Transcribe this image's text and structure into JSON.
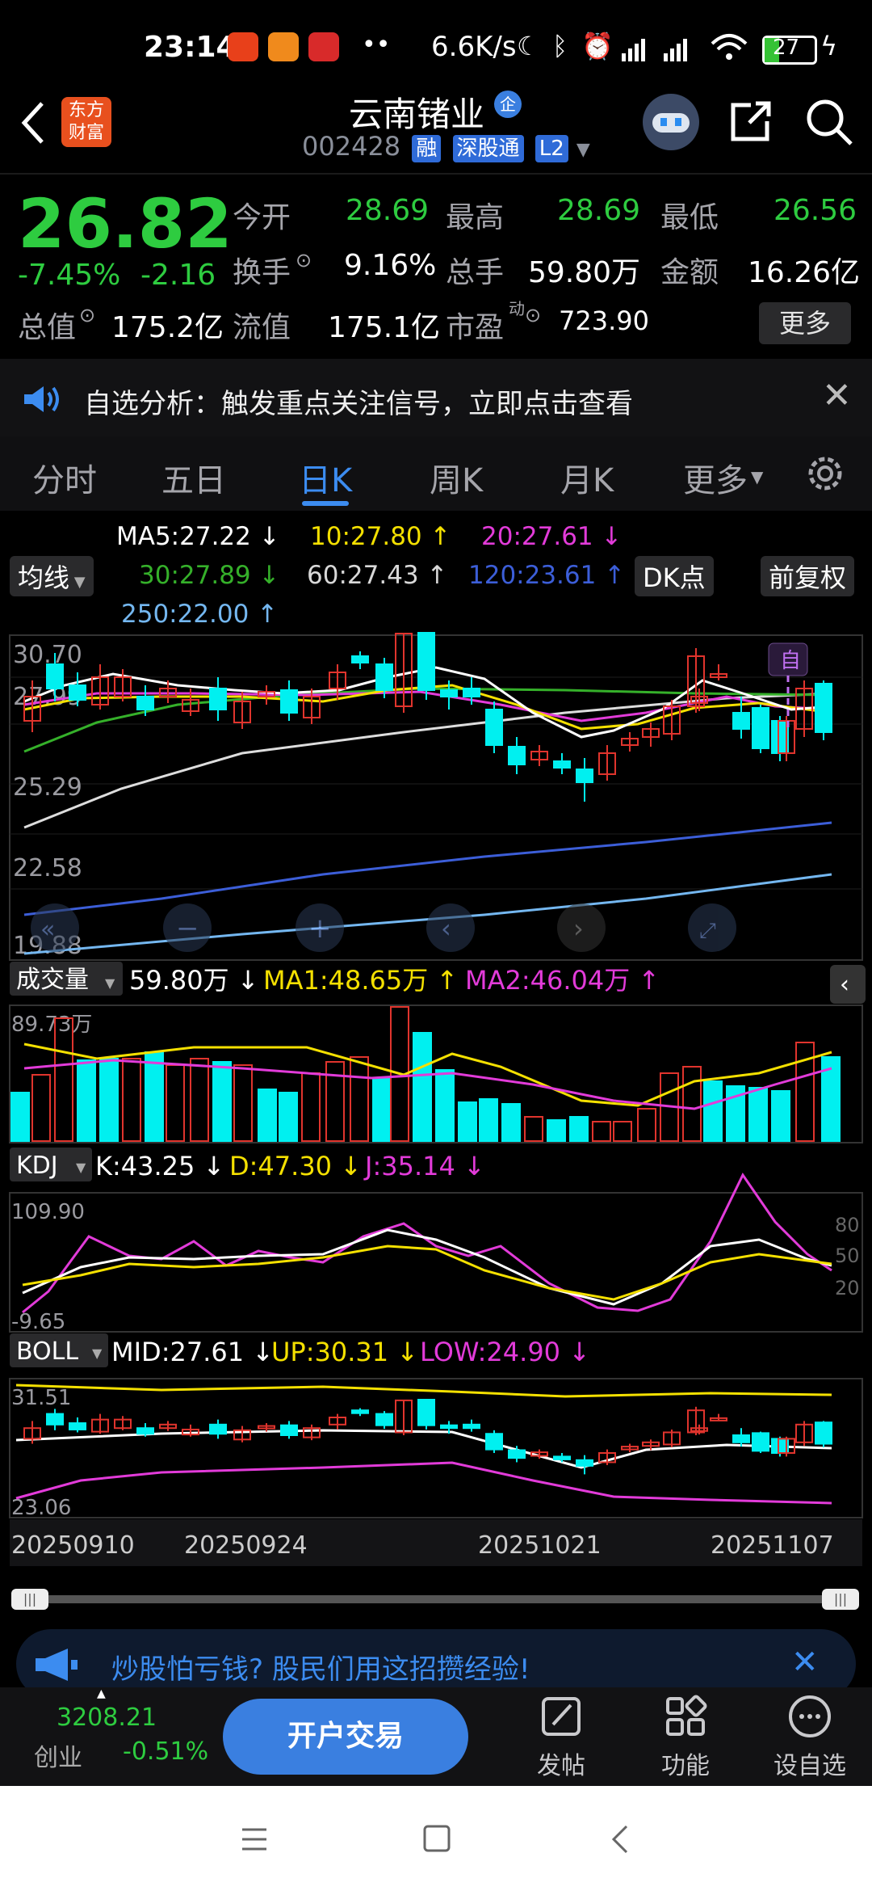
{
  "status": {
    "time": "23:14",
    "speed": "6.6K/s",
    "battery": "27"
  },
  "header": {
    "logo": "东方\n财富",
    "title": "云南锗业",
    "title_badge": "企",
    "code": "002428",
    "tags": [
      "融",
      "深股通",
      "L2"
    ]
  },
  "quote": {
    "price": "26.82",
    "change_pct": "-7.45%",
    "change": "-2.16",
    "open_label": "今开",
    "open": "28.69",
    "high_label": "最高",
    "high": "28.69",
    "low_label": "最低",
    "low": "26.56",
    "turnover_label": "换手",
    "turnover": "9.16%",
    "volume_label": "总手",
    "volume": "59.80万",
    "amount_label": "金额",
    "amount": "16.26亿",
    "mktcap_label": "总值",
    "mktcap": "175.2亿",
    "float_label": "流值",
    "float": "175.1亿",
    "pe_label": "市盈",
    "pe_sup": "动",
    "pe": "723.90",
    "more_label": "更多"
  },
  "notice": {
    "text": "自选分析：触发重点关注信号，立即点击查看"
  },
  "tabs": [
    {
      "label": "分时"
    },
    {
      "label": "五日"
    },
    {
      "label": "日K"
    },
    {
      "label": "周K"
    },
    {
      "label": "月K"
    },
    {
      "label": "更多"
    }
  ],
  "indicators": {
    "ma5": "MA5:27.22 ↓",
    "ma10": "10:27.80 ↑",
    "ma20": "20:27.61 ↓",
    "ma30": "30:27.89 ↓",
    "ma60": "60:27.43 ↑",
    "ma120": "120:23.61 ↑",
    "ma250": "250:22.00 ↑",
    "ma_selector": "均线",
    "dk_label": "DK点",
    "adjust_label": "前复权",
    "self_mark": "自"
  },
  "price_axis": [
    "30.70",
    "27.99",
    "25.29",
    "22.58",
    "19.88"
  ],
  "volume": {
    "selector": "成交量",
    "value": "59.80万 ↓",
    "ma1": "MA1:48.65万 ↑",
    "ma2": "MA2:46.04万 ↑",
    "axis_max": "89.73万"
  },
  "kdj": {
    "selector": "KDJ",
    "k": "K:43.25 ↓",
    "d": "D:47.30 ↓",
    "j": "J:35.14 ↓",
    "axis_top": "109.90",
    "axis_bottom": "-9.65",
    "levels": [
      "80",
      "50",
      "20"
    ]
  },
  "boll": {
    "selector": "BOLL",
    "mid": "MID:27.61 ↓",
    "up": "UP:30.31 ↓",
    "low": "LOW:24.90 ↓",
    "axis_top": "31.51",
    "axis_bottom": "23.06"
  },
  "dates": [
    "20250910",
    "20250924",
    "20251021",
    "20251107"
  ],
  "ad": {
    "text": "炒股怕亏钱? 股民们用这招攒经验!"
  },
  "bottom": {
    "index_value": "3208.21",
    "index_name": "创业",
    "index_change": "-0.51%",
    "trade_label": "开户交易",
    "post_label": "发帖",
    "func_label": "功能",
    "watch_label": "设自选"
  },
  "colors": {
    "up": "#e0342d",
    "down": "#00f0f0",
    "green_text": "#2ecc40",
    "accent": "#3c8cf0",
    "ma5": "#ffffff",
    "ma10": "#f4e000",
    "ma20": "#e23bd9",
    "ma30": "#35b02a",
    "ma120": "#3c5ed8",
    "ma250": "#74b7f0"
  }
}
